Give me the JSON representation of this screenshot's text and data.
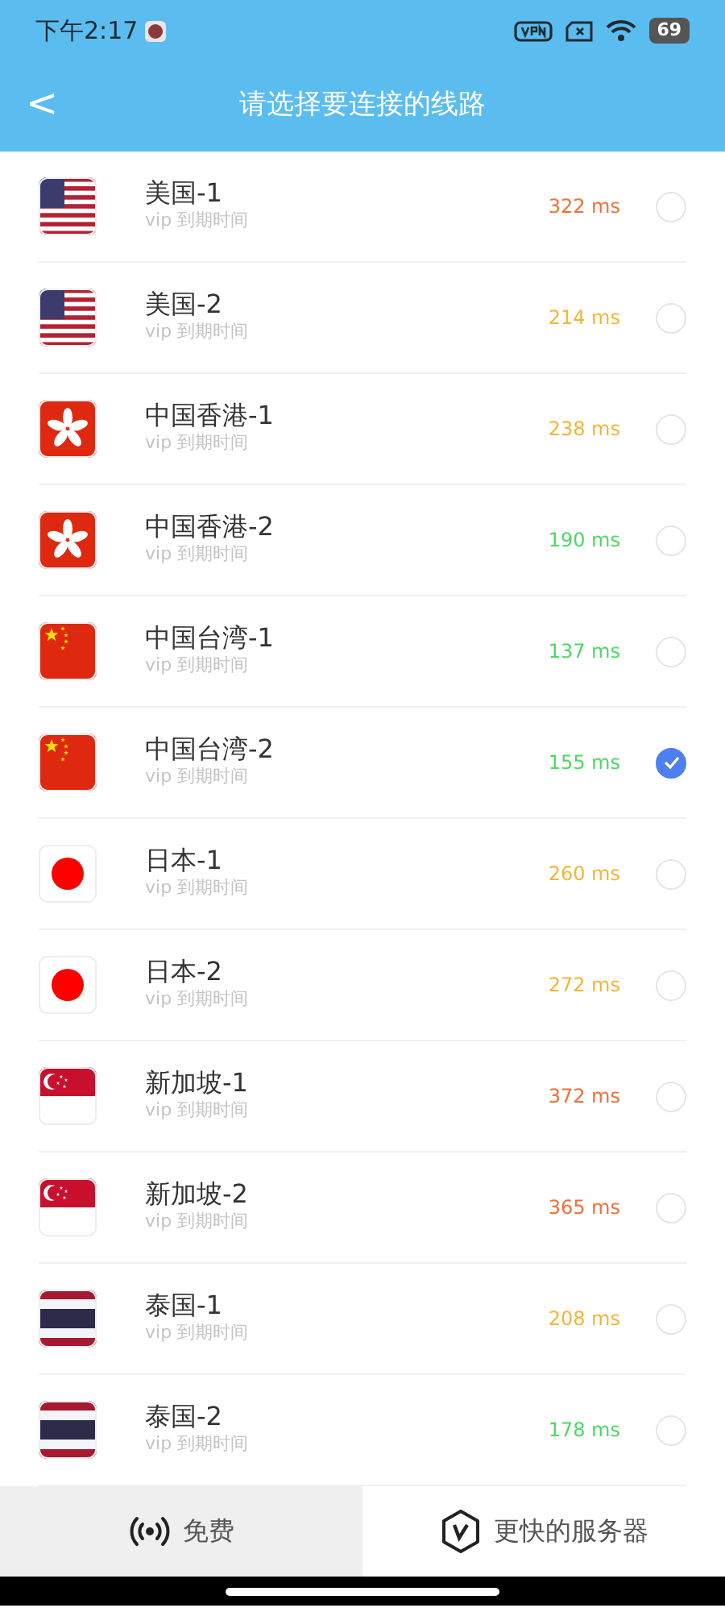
{
  "status_bar": {
    "time": "下午2:17",
    "battery": "69"
  },
  "header": {
    "back": "<",
    "title": "请选择要连接的线路"
  },
  "servers": [
    {
      "kind": "us",
      "name": "美国-1",
      "subtitle": "vip 到期时间",
      "ping": "322 ms",
      "color": "#f0703a",
      "selected": false
    },
    {
      "kind": "us",
      "name": "美国-2",
      "subtitle": "vip 到期时间",
      "ping": "214 ms",
      "color": "#f5b43a",
      "selected": false
    },
    {
      "kind": "hk",
      "name": "中国香港-1",
      "subtitle": "vip 到期时间",
      "ping": "238 ms",
      "color": "#f5b43a",
      "selected": false
    },
    {
      "kind": "hk",
      "name": "中国香港-2",
      "subtitle": "vip 到期时间",
      "ping": "190 ms",
      "color": "#4cd964",
      "selected": false
    },
    {
      "kind": "cn",
      "name": "中国台湾-1",
      "subtitle": "vip 到期时间",
      "ping": "137 ms",
      "color": "#4cd964",
      "selected": false
    },
    {
      "kind": "cn",
      "name": "中国台湾-2",
      "subtitle": "vip 到期时间",
      "ping": "155 ms",
      "color": "#4cd964",
      "selected": true
    },
    {
      "kind": "jp",
      "name": "日本-1",
      "subtitle": "vip 到期时间",
      "ping": "260 ms",
      "color": "#f5b43a",
      "selected": false
    },
    {
      "kind": "jp",
      "name": "日本-2",
      "subtitle": "vip 到期时间",
      "ping": "272 ms",
      "color": "#f5b43a",
      "selected": false
    },
    {
      "kind": "sg",
      "name": "新加坡-1",
      "subtitle": "vip 到期时间",
      "ping": "372 ms",
      "color": "#f0703a",
      "selected": false
    },
    {
      "kind": "sg",
      "name": "新加坡-2",
      "subtitle": "vip 到期时间",
      "ping": "365 ms",
      "color": "#f0703a",
      "selected": false
    },
    {
      "kind": "th",
      "name": "泰国-1",
      "subtitle": "vip 到期时间",
      "ping": "208 ms",
      "color": "#f5b43a",
      "selected": false
    },
    {
      "kind": "th",
      "name": "泰国-2",
      "subtitle": "vip 到期时间",
      "ping": "178 ms",
      "color": "#4cd964",
      "selected": false
    }
  ],
  "bottom_tabs": [
    {
      "kind": "free",
      "label": "免费",
      "selected": true
    },
    {
      "kind": "fast",
      "label": "更快的服务器",
      "selected": false
    }
  ]
}
